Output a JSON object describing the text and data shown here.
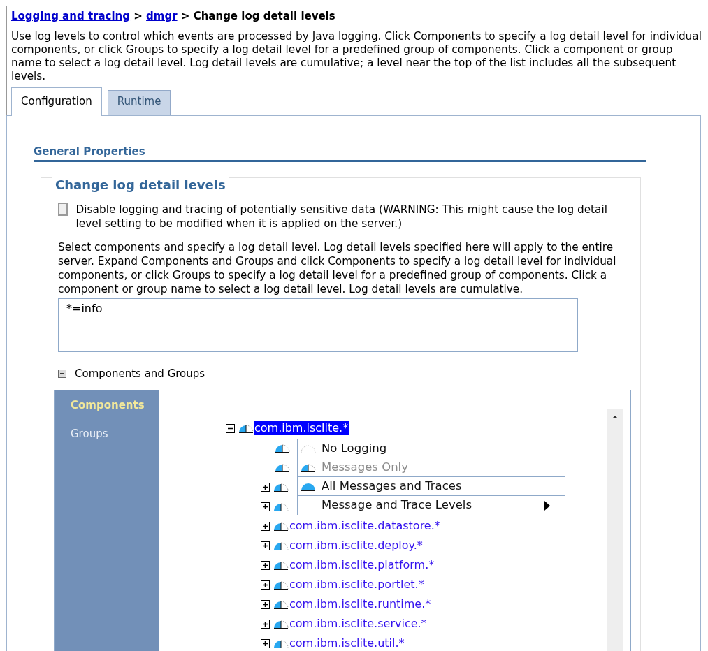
{
  "breadcrumb": [
    {
      "kind": "link",
      "text": "Logging and tracing"
    },
    {
      "kind": "sep",
      "text": ">"
    },
    {
      "kind": "link",
      "text": "dmgr"
    },
    {
      "kind": "sep",
      "text": ">"
    },
    {
      "kind": "current",
      "text": "Change log detail levels"
    }
  ],
  "description": "Use log levels to control which events are processed by Java logging. Click Components to specify a log detail level for individual components, or click Groups to specify a log detail level for a predefined group of components. Click a component or group name to select a log detail level. Log detail levels are cumulative; a level near the top of the list includes all the subsequent levels.",
  "tabs": [
    {
      "label": "Configuration",
      "selected": true
    },
    {
      "label": "Runtime",
      "selected": false
    }
  ],
  "section_title": "General Properties",
  "fieldset": {
    "legend": "Change log detail levels",
    "sensitive_checkbox": {
      "label": "Disable logging and tracing of potentially sensitive data (WARNING: This might cause the log detail level setting to be modified when it is applied on the server.)",
      "checked": false
    },
    "instructions": "Select components and specify a log detail level. Log detail levels specified here will apply to the entire server. Expand Components and Groups and click Components to specify a log detail level for individual components, or click Groups to specify a log detail level for a predefined group of components. Click a component or group name to select a log detail level. Log detail levels are cumulative.",
    "levels_field": {
      "value": "*=info"
    },
    "components_section": {
      "label": "Components and Groups",
      "expanded": true
    }
  },
  "nav": [
    {
      "label": "Components",
      "selected": true
    },
    {
      "label": "Groups",
      "selected": false
    }
  ],
  "tree": [
    {
      "kind": "folder",
      "label": "com.ibm.isclite.*",
      "expanded": true,
      "selected": true,
      "children": [
        {
          "kind": "leaf",
          "selected": false
        },
        {
          "kind": "leaf",
          "selected": false
        },
        {
          "kind": "folder",
          "expanded": false,
          "selected": false
        },
        {
          "kind": "folder",
          "expanded": false,
          "selected": false
        },
        {
          "kind": "folder",
          "label": "com.ibm.isclite.datastore.*",
          "expanded": false,
          "selected": false
        },
        {
          "kind": "folder",
          "label": "com.ibm.isclite.deploy.*",
          "expanded": false,
          "selected": false
        },
        {
          "kind": "folder",
          "label": "com.ibm.isclite.platform.*",
          "expanded": false,
          "selected": false
        },
        {
          "kind": "folder",
          "label": "com.ibm.isclite.portlet.*",
          "expanded": false,
          "selected": false
        },
        {
          "kind": "folder",
          "label": "com.ibm.isclite.runtime.*",
          "expanded": false,
          "selected": false
        },
        {
          "kind": "folder",
          "label": "com.ibm.isclite.service.*",
          "expanded": false,
          "selected": false
        },
        {
          "kind": "folder",
          "label": "com.ibm.isclite.util.*",
          "expanded": false,
          "selected": false
        }
      ]
    }
  ],
  "context_menu": [
    {
      "label": "No Logging",
      "kind": "none",
      "disabled": false
    },
    {
      "label": "Messages Only",
      "kind": "partial",
      "disabled": true
    },
    {
      "label": "All Messages and Traces",
      "kind": "full",
      "disabled": false
    },
    {
      "label": "Message and Trace Levels",
      "kind": "submenu",
      "disabled": false
    }
  ]
}
